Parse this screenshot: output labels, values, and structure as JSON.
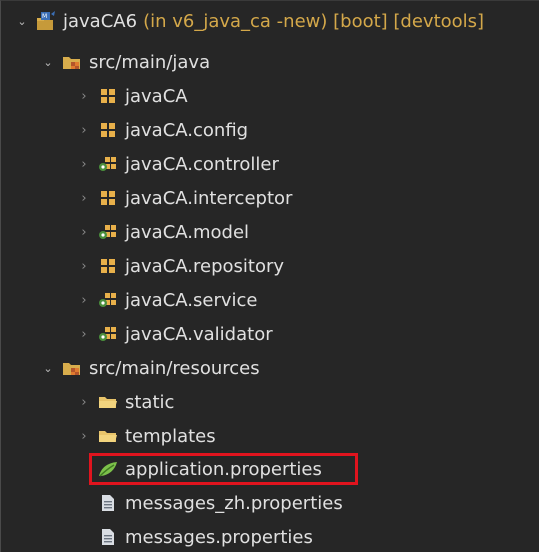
{
  "project": {
    "name": "javaCA6",
    "decoration": "(in v6_java_ca -new) [boot] [devtools]",
    "icon": "java-project-icon"
  },
  "source_folders": [
    {
      "label": "src/main/java",
      "icon": "source-folder-icon",
      "packages": [
        {
          "label": "javaCA",
          "icon": "package-icon"
        },
        {
          "label": "javaCA.config",
          "icon": "package-icon"
        },
        {
          "label": "javaCA.controller",
          "icon": "package-with-class-icon"
        },
        {
          "label": "javaCA.interceptor",
          "icon": "package-icon"
        },
        {
          "label": "javaCA.model",
          "icon": "package-with-class-icon"
        },
        {
          "label": "javaCA.repository",
          "icon": "package-icon"
        },
        {
          "label": "javaCA.service",
          "icon": "package-with-class-icon"
        },
        {
          "label": "javaCA.validator",
          "icon": "package-with-class-icon"
        }
      ]
    },
    {
      "label": "src/main/resources",
      "icon": "source-folder-icon",
      "folders": [
        {
          "label": "static",
          "icon": "folder-icon"
        },
        {
          "label": "templates",
          "icon": "folder-icon"
        }
      ],
      "files": [
        {
          "label": "application.properties",
          "icon": "spring-leaf-icon",
          "selected": true
        },
        {
          "label": "messages_zh.properties",
          "icon": "text-file-icon"
        },
        {
          "label": "messages.properties",
          "icon": "text-file-icon"
        }
      ]
    }
  ],
  "colors": {
    "background": "#262626",
    "text": "#e0e0e0",
    "decoration": "#d4a84a",
    "highlight_border": "#e0141e"
  }
}
